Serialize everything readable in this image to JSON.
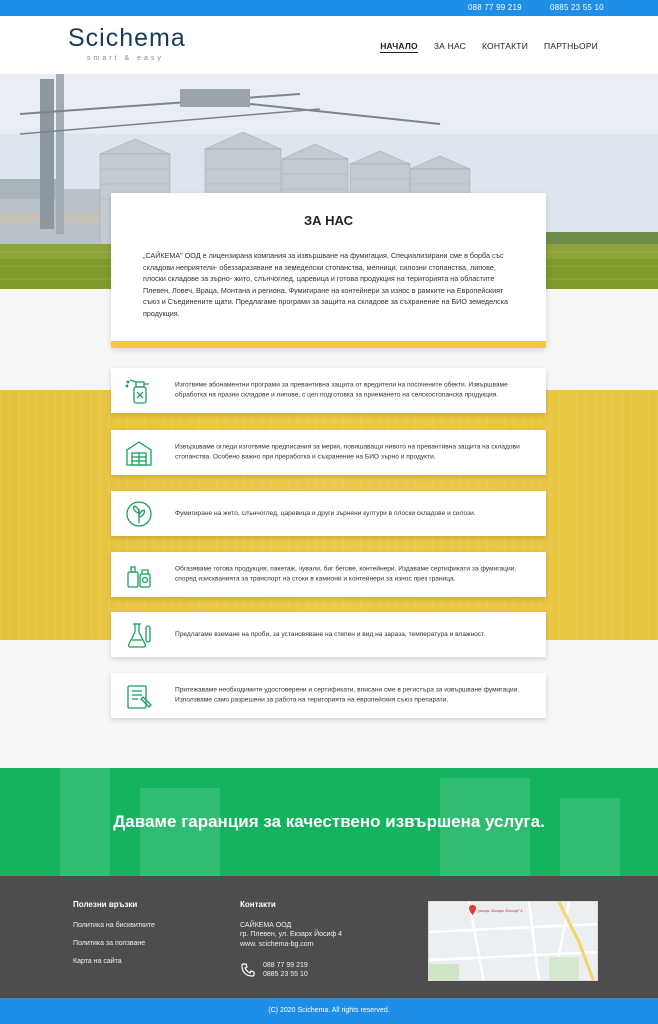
{
  "topbar": {
    "phone1": "088 77 99 219",
    "phone2": "0885 23 55 10"
  },
  "header": {
    "logo_text": "Scichema",
    "logo_tagline": "smart & easy",
    "nav": [
      {
        "label": "НАЧАЛО"
      },
      {
        "label": "ЗА НАС"
      },
      {
        "label": "КОНТАКТИ"
      },
      {
        "label": "ПАРТНЬОРИ"
      }
    ]
  },
  "about": {
    "title": "ЗА НАС",
    "text": "„САЙКЕМА\" ООД е лицензирана компания за извършване на фумигация. Специализирани сме в борба със складови неприятели- обеззаразяване на земеделски стопанства, мелници, силозни стопанства, липове, плоски складове за зърно- жито, слънчоглед, царевица и готова продукция на територията на областите Плевен, Ловеч, Враца, Монтана и региона. Фумигиране на контейнери за износ в рамките на Европейският съюз и Съединените щати. Предлагаме програми за защита на складове за съхранение на БИО земеделска продукция."
  },
  "services": [
    {
      "icon": "spray-bottle-icon",
      "text": "Изготвяме абонаментни програми за превантивна защита от вредители на посочените обекти. Извършваме обработка на празни складове и липове, с цел подготовка за приемането на селскостопанска продукция."
    },
    {
      "icon": "warehouse-icon",
      "text": "Извършваме огледи изготвяме предписания за мерки, повишаващи нивото на превантивна защита на складови стопанства. Особено важно при преработка и съхранение на БИО зърно и продукти."
    },
    {
      "icon": "grain-leaf-icon",
      "text": "Фумигиране на жито, слънчоглед, царевица и други зърнени култури в плоски складове и силози."
    },
    {
      "icon": "chemical-bottles-icon",
      "text": "Обгазяваме готова продукция, пакетаж, чували, биг бегове, контейнери. Издаваме сертификати за фумигации, според изискванията за транспорт на стоки в камиони и контейнери за износ през граница."
    },
    {
      "icon": "lab-flask-icon",
      "text": "Предлагаме вземане на проби, за установяване на степен и вид на зараза, температура и влажност."
    },
    {
      "icon": "certificate-icon",
      "text": "Притежаваме необходимите удостоверени и сертификати, вписани сме в регистъра за извършване фумигации. Използваме само разрешени за работа на територията на европейския съюз препарати."
    }
  ],
  "guarantee": {
    "text": "Даваме гаранция за качествено извършена услуга."
  },
  "footer": {
    "links_title": "Полезни връзки",
    "links": [
      "Политика на бисквитките",
      "Политика за ползване",
      "Карта на сайта"
    ],
    "contacts_title": "Контакти",
    "company": "САЙКЕМА ООД",
    "address": "гр. Плевен, ул. Екзарх Йосиф 4",
    "website": "www. scichema-bg.com",
    "phone1": "088 77 99 219",
    "phone2": "0885 23 55 10",
    "map_pin_label": "улица „Екзарх Йосиф\" 4"
  },
  "copyright": "(C) 2020 Scichema. All rights reserved.",
  "colors": {
    "topbar": "#1e8ee6",
    "accent_yellow": "#f7c83a",
    "icon_green": "#19a15b",
    "guarantee_green": "#14b35f",
    "footer": "#4d4d4d"
  }
}
